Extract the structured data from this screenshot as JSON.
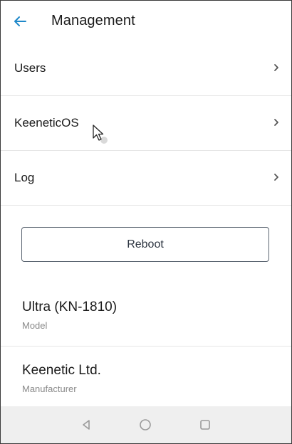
{
  "header": {
    "title": "Management",
    "accent_color": "#1e88c9"
  },
  "menu": [
    {
      "label": "Users"
    },
    {
      "label": "KeeneticOS"
    },
    {
      "label": "Log"
    }
  ],
  "actions": {
    "reboot_label": "Reboot"
  },
  "device": {
    "model_value": "Ultra (KN-1810)",
    "model_label": "Model",
    "manufacturer_value": "Keenetic Ltd.",
    "manufacturer_label": "Manufacturer"
  },
  "navbar": {
    "icons": [
      "back-triangle-icon",
      "home-circle-icon",
      "recents-square-icon"
    ]
  }
}
